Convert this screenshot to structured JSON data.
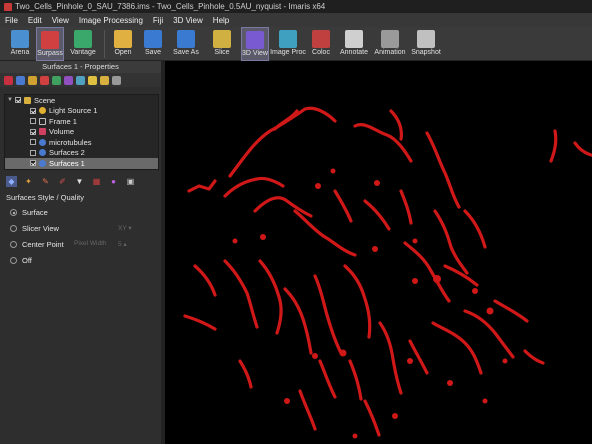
{
  "window": {
    "title": "Two_Cells_Pinhole_0_SAU_7386.ims - Two_Cells_Pinhole_0.5AU_nyquist - Imaris x64"
  },
  "menu": [
    "File",
    "Edit",
    "View",
    "Image Processing",
    "Fiji",
    "3D View",
    "Help"
  ],
  "toolbar": [
    {
      "label": "Arena",
      "icon": "arena-icon",
      "color": "#4a90d0"
    },
    {
      "label": "Surpass",
      "icon": "surpass-icon",
      "color": "#d04040",
      "active": true
    },
    {
      "label": "Vantage",
      "icon": "vantage-icon",
      "color": "#3aa86a"
    },
    {
      "label": "Open",
      "icon": "folder-open-icon",
      "color": "#e0b040"
    },
    {
      "label": "Save",
      "icon": "save-icon",
      "color": "#3a7ad0"
    },
    {
      "label": "Save As",
      "icon": "save-as-icon",
      "color": "#3a7ad0"
    },
    {
      "label": "Slice",
      "icon": "slice-icon",
      "color": "#d0b040"
    },
    {
      "label": "3D View",
      "icon": "3d-view-icon",
      "color": "#7a5ad0",
      "active": true
    },
    {
      "label": "Image Proc",
      "icon": "image-proc-icon",
      "color": "#40a0c0"
    },
    {
      "label": "Coloc",
      "icon": "coloc-icon",
      "color": "#c04040"
    },
    {
      "label": "Annotate",
      "icon": "annotate-icon",
      "color": "#cfcfcf"
    },
    {
      "label": "Animation",
      "icon": "animation-icon",
      "color": "#9a9a9a"
    },
    {
      "label": "Snapshot",
      "icon": "snapshot-icon",
      "color": "#c0c0c0"
    }
  ],
  "panel": {
    "title": "Surfaces 1 - Properties",
    "tree": [
      {
        "label": "Scene",
        "indent": 0,
        "checked": true,
        "icon": "folder-icon",
        "color": "#d8b040"
      },
      {
        "label": "Light Source 1",
        "indent": 1,
        "checked": true,
        "icon": "light-source-icon",
        "color": "#e0b030"
      },
      {
        "label": "Frame 1",
        "indent": 1,
        "checked": false,
        "icon": "frame-icon",
        "color": "#c0c0c0"
      },
      {
        "label": "Volume",
        "indent": 1,
        "checked": true,
        "icon": "volume-icon",
        "color": "#d04060"
      },
      {
        "label": "microtubules",
        "indent": 1,
        "checked": false,
        "icon": "surface-icon",
        "color": "#4a7ad0"
      },
      {
        "label": "Surfaces 2",
        "indent": 1,
        "checked": false,
        "icon": "surface-icon",
        "color": "#4a7ad0"
      },
      {
        "label": "Surfaces 1",
        "indent": 1,
        "checked": true,
        "icon": "surface-icon",
        "color": "#4a7ad0",
        "selected": true
      }
    ],
    "section_title": "Surfaces Style / Quality",
    "options": [
      {
        "label": "Surface",
        "selected": true
      },
      {
        "label": "Slicer View",
        "selected": false
      },
      {
        "label": "Center Point",
        "selected": false
      },
      {
        "label": "Off",
        "selected": false
      }
    ],
    "slicer_value": "XY",
    "pixel_width_label": "Pixel Width",
    "pixel_width_value": "5"
  },
  "colors": {
    "accent": "#d01818",
    "background": "#000000"
  }
}
